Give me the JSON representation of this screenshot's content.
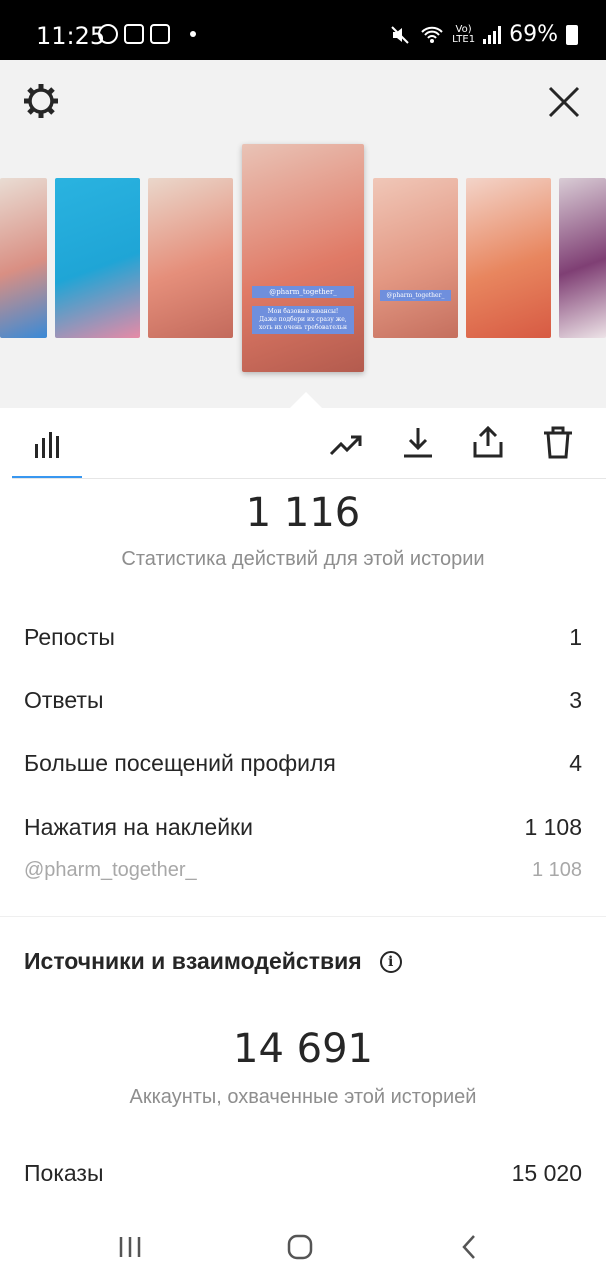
{
  "status_bar": {
    "time": "11:25",
    "network_label_top": "Vo)",
    "network_label_bottom": "LTE1",
    "battery": "69%"
  },
  "header": {
    "settings_icon": "gear-icon",
    "close_icon": "close-icon"
  },
  "story_thumbnails": [
    {
      "colors": [
        "#e9dcd3",
        "#d98f83",
        "#3a8ad6"
      ],
      "sticker": ""
    },
    {
      "colors": [
        "#2ab3e0",
        "#1fa5d6",
        "#e78aa6"
      ],
      "sticker": ""
    },
    {
      "colors": [
        "#ead7cb",
        "#e58f7b",
        "#c36a5c"
      ],
      "sticker": ""
    },
    {
      "colors": [
        "#e9c3b6",
        "#e07a66",
        "#b35b4e"
      ],
      "sticker": "@pharm_together_",
      "selected": true
    },
    {
      "colors": [
        "#f0c7b8",
        "#e39883",
        "#c56f5e"
      ],
      "sticker": "@pharm_together_"
    },
    {
      "colors": [
        "#f3d4c9",
        "#e8865f",
        "#d75a43"
      ],
      "sticker": ""
    },
    {
      "colors": [
        "#d9ccd5",
        "#7f3f74",
        "#ede3e7"
      ],
      "sticker": ""
    }
  ],
  "selected_sticker_lines": [
    "@pharm_together_",
    "Мои базовые нюансы!",
    "Даже подбери их сразу же,",
    "хоть их очень требовательн"
  ],
  "tabs": {
    "insights_icon": "bar-chart-icon",
    "actions": [
      "trend-icon",
      "download-icon",
      "share-icon",
      "trash-icon"
    ]
  },
  "interactions": {
    "total": "1 116",
    "caption": "Статистика действий для этой истории",
    "rows": [
      {
        "label": "Репосты",
        "value": "1"
      },
      {
        "label": "Ответы",
        "value": "3"
      },
      {
        "label": "Больше посещений профиля",
        "value": "4"
      },
      {
        "label": "Нажатия на наклейки",
        "value": "1 108"
      }
    ],
    "sticker_row": {
      "label": "@pharm_together_",
      "value": "1 108"
    }
  },
  "discovery": {
    "title": "Источники и взаимодействия",
    "info_icon_glyph": "i",
    "reach": "14 691",
    "reach_caption": "Аккаунты, охваченные этой историей",
    "impressions_label": "Показы",
    "impressions_value": "15 020"
  },
  "nav": [
    "recent-apps-icon",
    "home-icon",
    "back-icon"
  ]
}
